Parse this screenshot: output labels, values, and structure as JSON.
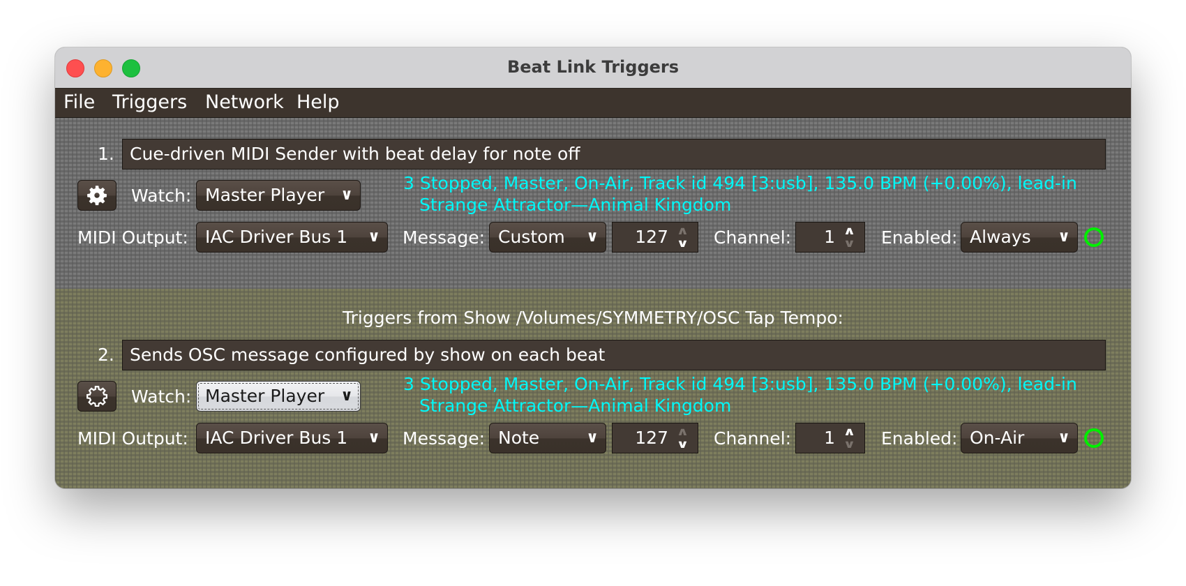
{
  "window": {
    "title": "Beat Link Triggers"
  },
  "menubar": {
    "items": [
      "File",
      "Triggers",
      "Network",
      "Help"
    ]
  },
  "colors": {
    "status_text": "#00f7f7",
    "indicator": "#00ee00",
    "panel1_bg": "#7a7a7a",
    "panel2_bg": "#7e7e5e"
  },
  "labels": {
    "watch": "Watch:",
    "midi_output": "MIDI Output:",
    "message": "Message:",
    "channel": "Channel:",
    "enabled": "Enabled:"
  },
  "icons": {
    "gear_filled": "gear-icon",
    "gear_outline": "gear-outline-icon",
    "chevron": "chevron-down-icon",
    "spinner_up": "spinner-up-icon",
    "spinner_down": "spinner-down-icon",
    "indicator": "status-circle-icon"
  },
  "triggers": [
    {
      "index": "1.",
      "comment": "Cue-driven MIDI Sender with beat delay for note off",
      "watch": "Master Player",
      "status_line1": "3 Stopped, Master, On-Air, Track id 494 [3:usb], 135.0 BPM (+0.00%), lead-in",
      "status_line2": "Strange Attractor—Animal Kingdom",
      "midi_output": "IAC Driver Bus 1",
      "message": "Custom",
      "note": "127",
      "channel": "1",
      "enabled": "Always"
    },
    {
      "index": "2.",
      "show_header": "Triggers from Show /Volumes/SYMMETRY/OSC Tap Tempo:",
      "comment": "Sends OSC message configured by show on each beat",
      "watch": "Master Player",
      "status_line1": "3 Stopped, Master, On-Air, Track id 494 [3:usb], 135.0 BPM (+0.00%), lead-in",
      "status_line2": "Strange Attractor—Animal Kingdom",
      "midi_output": "IAC Driver Bus 1",
      "message": "Note",
      "note": "127",
      "channel": "1",
      "enabled": "On-Air"
    }
  ]
}
